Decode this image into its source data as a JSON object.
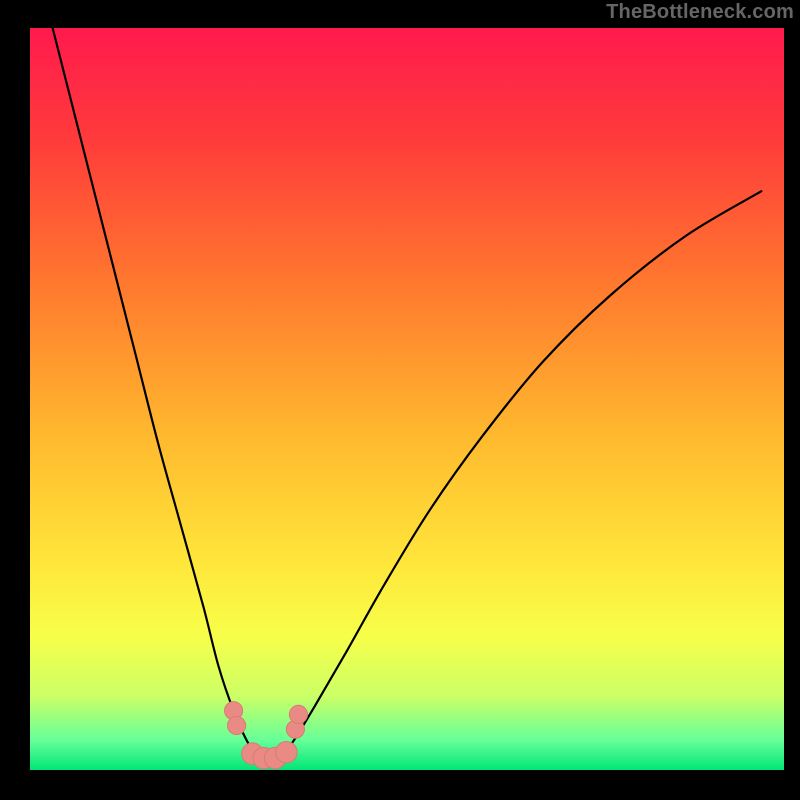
{
  "watermark": "TheBottleneck.com",
  "colors": {
    "frame": "#000000",
    "gradient_stops": [
      {
        "offset": 0.0,
        "color": "#ff1a4d"
      },
      {
        "offset": 0.15,
        "color": "#ff3b3b"
      },
      {
        "offset": 0.35,
        "color": "#ff7a2e"
      },
      {
        "offset": 0.55,
        "color": "#ffb92e"
      },
      {
        "offset": 0.72,
        "color": "#ffe63a"
      },
      {
        "offset": 0.82,
        "color": "#f7ff4a"
      },
      {
        "offset": 0.9,
        "color": "#ccff66"
      },
      {
        "offset": 0.96,
        "color": "#66ff99"
      },
      {
        "offset": 1.0,
        "color": "#00e676"
      }
    ],
    "curve": "#000000",
    "marker_fill": "#e98b84",
    "marker_stroke": "#d97a73"
  },
  "chart_data": {
    "type": "line",
    "title": "",
    "xlabel": "",
    "ylabel": "",
    "xlim": [
      0,
      100
    ],
    "ylim": [
      0,
      100
    ],
    "series": [
      {
        "name": "bottleneck-curve",
        "x": [
          3,
          5,
          8,
          11,
          14,
          17,
          20,
          23,
          25,
          27,
          29,
          30.5,
          32,
          33.5,
          35,
          38,
          42,
          47,
          53,
          60,
          68,
          77,
          87,
          97
        ],
        "y": [
          100,
          92,
          80,
          68,
          56,
          44,
          33,
          22,
          14,
          8,
          3.5,
          1.8,
          1.5,
          2.2,
          4,
          9,
          16,
          25,
          35,
          45,
          55,
          64,
          72,
          78
        ]
      }
    ],
    "markers": {
      "name": "highlight-points",
      "x": [
        27.0,
        27.4,
        29.5,
        31.0,
        32.5,
        34.0,
        35.2,
        35.6
      ],
      "y": [
        8.0,
        6.0,
        2.2,
        1.6,
        1.6,
        2.4,
        5.5,
        7.5
      ],
      "r": [
        1.6,
        1.6,
        1.9,
        1.9,
        1.9,
        1.9,
        1.6,
        1.6
      ]
    }
  }
}
